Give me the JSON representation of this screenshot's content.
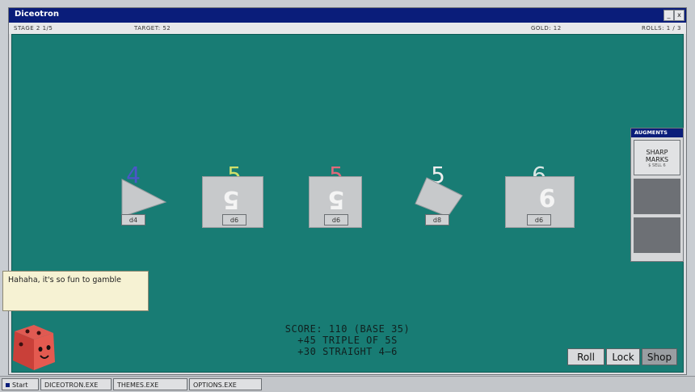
{
  "window": {
    "title": "Diceotron",
    "minimize": "_",
    "close": "x"
  },
  "status": {
    "stage": "STAGE 2  1/5",
    "target": "TARGET: 52",
    "gold": "GOLD: 12",
    "rolls": "ROLLS: 1 / 3"
  },
  "dice": [
    {
      "value": "4",
      "face": "",
      "type": "d4",
      "color": "#4b56c9"
    },
    {
      "value": "5",
      "face": "5",
      "type": "d6",
      "color": "#cfe06a"
    },
    {
      "value": "5",
      "face": "5",
      "type": "d6",
      "color": "#e0697a"
    },
    {
      "value": "5",
      "face": "5",
      "type": "d8",
      "color": "#eeeeee"
    },
    {
      "value": "6",
      "face": "6",
      "type": "d6",
      "color": "#d9e6e4"
    }
  ],
  "augments": {
    "title": "AUGMENTS",
    "slots": [
      {
        "name_line1": "SHARP",
        "name_line2": "MARKS",
        "price": "$ SELL 6"
      }
    ]
  },
  "dialog": {
    "text": "Hahaha, it's so fun to gamble"
  },
  "score": {
    "line1": "SCORE: 110 (BASE 35)",
    "line2": "+45 TRIPLE OF 5S",
    "line3": "+30 STRAIGHT 4–6"
  },
  "actions": {
    "roll": "Roll",
    "lock": "Lock",
    "shop": "Shop"
  },
  "taskbar": {
    "start": "Start",
    "items": [
      "DICEOTRON.EXE",
      "THEMES.EXE",
      "OPTIONS.EXE"
    ]
  }
}
